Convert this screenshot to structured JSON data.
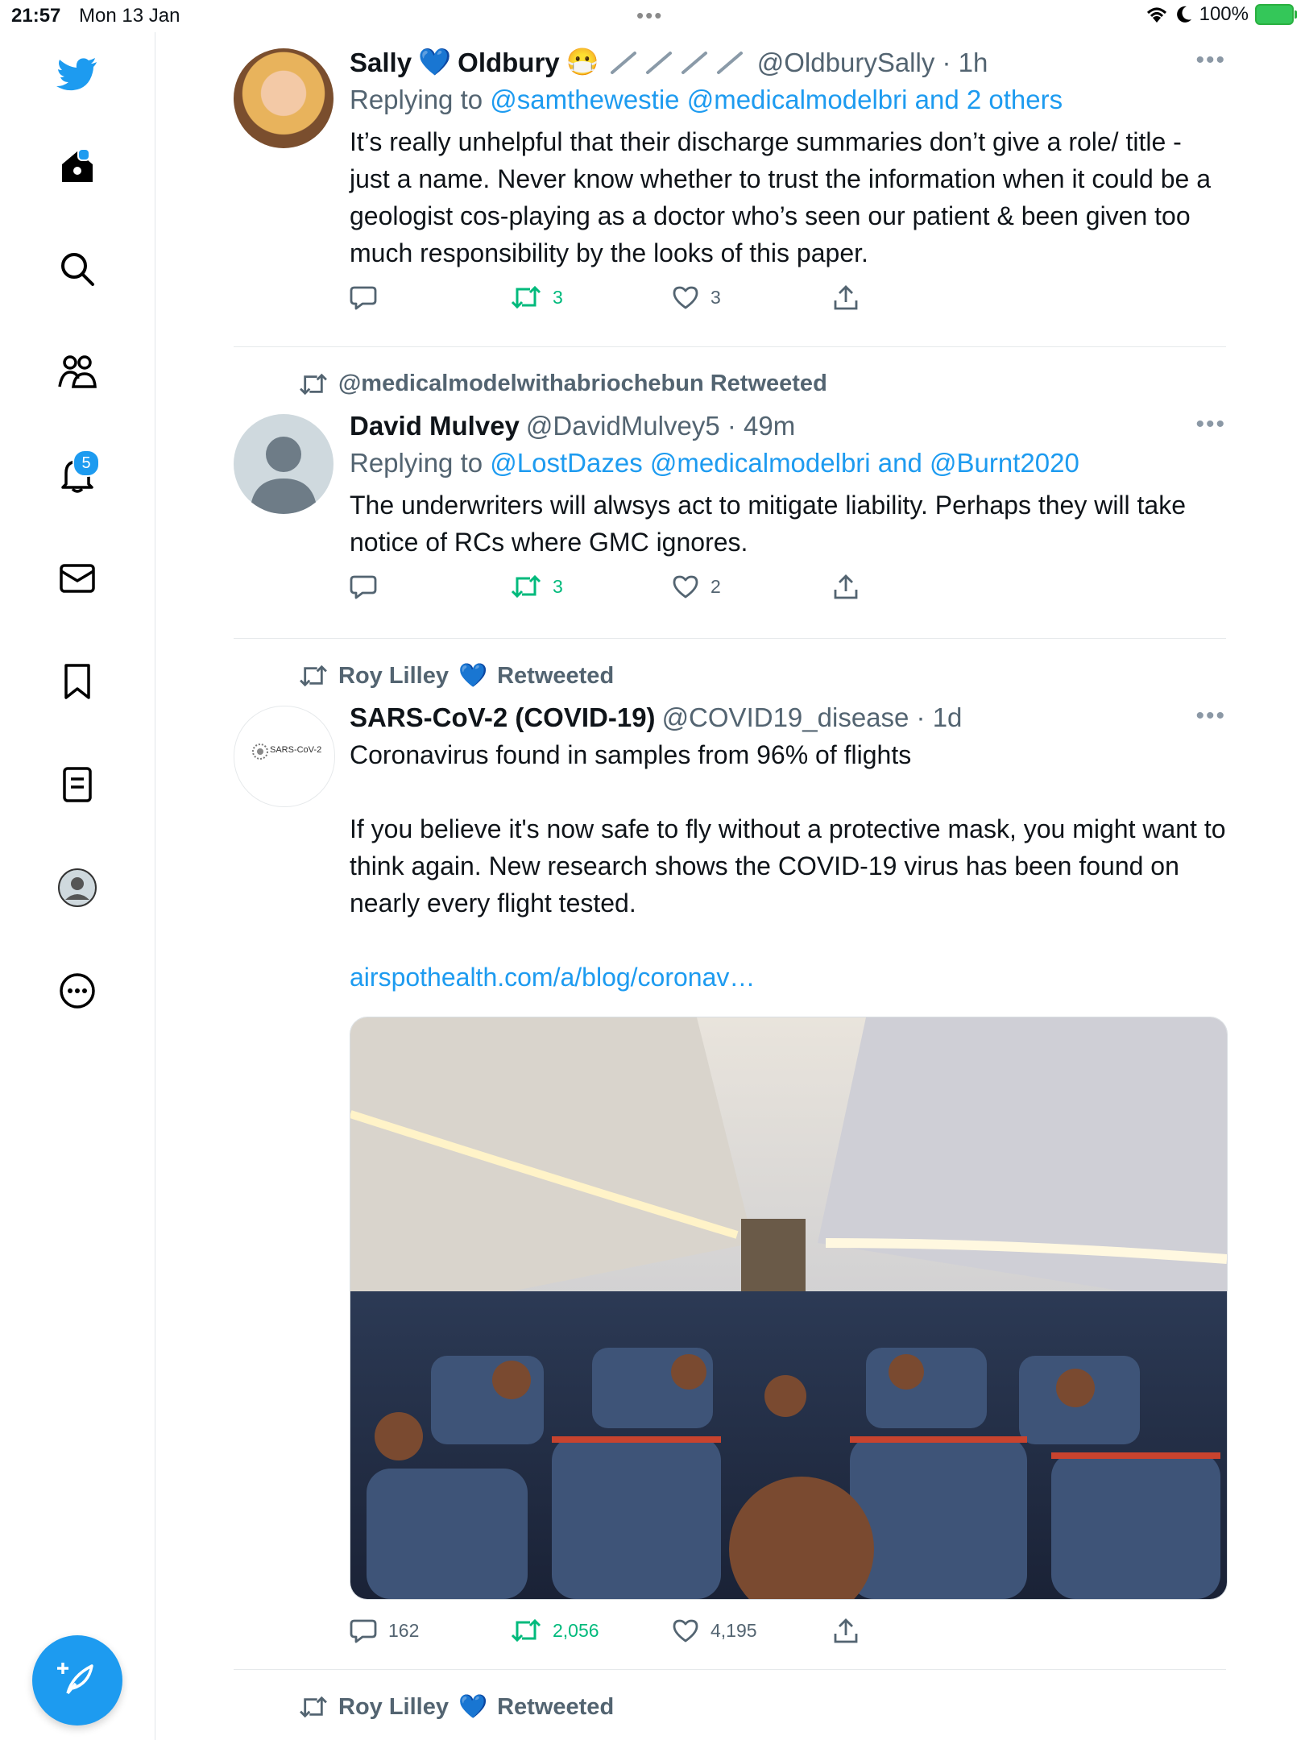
{
  "status_bar": {
    "time": "21:57",
    "date": "Mon 13 Jan",
    "battery": "100%"
  },
  "sidebar": {
    "items": [
      {
        "name": "home",
        "icon": "home-icon"
      },
      {
        "name": "search",
        "icon": "search-icon"
      },
      {
        "name": "communities",
        "icon": "communities-icon"
      },
      {
        "name": "notifications",
        "icon": "bell-icon",
        "badge": "5"
      },
      {
        "name": "messages",
        "icon": "envelope-icon"
      },
      {
        "name": "bookmarks",
        "icon": "bookmark-icon"
      },
      {
        "name": "lists",
        "icon": "list-icon"
      },
      {
        "name": "profile",
        "icon": "avatar-icon"
      },
      {
        "name": "more",
        "icon": "more-circle-icon"
      }
    ]
  },
  "tweets": [
    {
      "display_name_first": "Sally",
      "display_name_second": "Oldbury",
      "emoji": "😷",
      "handle_time": "@OldburySally · 1h",
      "replying_prefix": "Replying to",
      "replying_links": "@samthewestie @medicalmodelbri and 2 others",
      "text": "It’s really unhelpful that their discharge summaries don’t give a role/ title - just a name. Never know whether to trust the information when it could be a geologist cos-playing as a doctor who’s seen our patient & been given too much responsibility by the looks of this paper.",
      "replies": "",
      "retweets": "3",
      "likes": "3"
    },
    {
      "retweeted_by": "@medicalmodelwithabriochebun Retweeted",
      "display_name": "David Mulvey",
      "handle_time": "@DavidMulvey5 · 49m",
      "replying_prefix": "Replying to",
      "replying_links": "@LostDazes @medicalmodelbri and @Burnt2020",
      "text": "The underwriters will alwsys act to mitigate liability. Perhaps they will take notice of RCs where GMC ignores.",
      "replies": "",
      "retweets": "3",
      "likes": "2"
    },
    {
      "retweeted_by_name": "Roy Lilley",
      "retweeted_suffix": "Retweeted",
      "display_name": "SARS-CoV-2 (COVID-19)",
      "handle_time": "@COVID19_disease · 1d",
      "avatar_text": "SARS-CoV-2",
      "text": "Coronavirus found in samples from 96% of flights\n\nIf you believe it's now safe to fly without a protective mask, you might want to think again. New research shows the COVID-19 virus has been found on nearly every flight tested.\n\n",
      "link": "airspothealth.com/a/blog/coronav…",
      "replies": "162",
      "retweets": "2,056",
      "likes": "4,195"
    },
    {
      "retweeted_by_name": "Roy Lilley",
      "retweeted_suffix": "Retweeted"
    }
  ],
  "colors": {
    "accent": "#1d9bf0",
    "retweet": "#00ba7c",
    "muted": "#536471"
  }
}
